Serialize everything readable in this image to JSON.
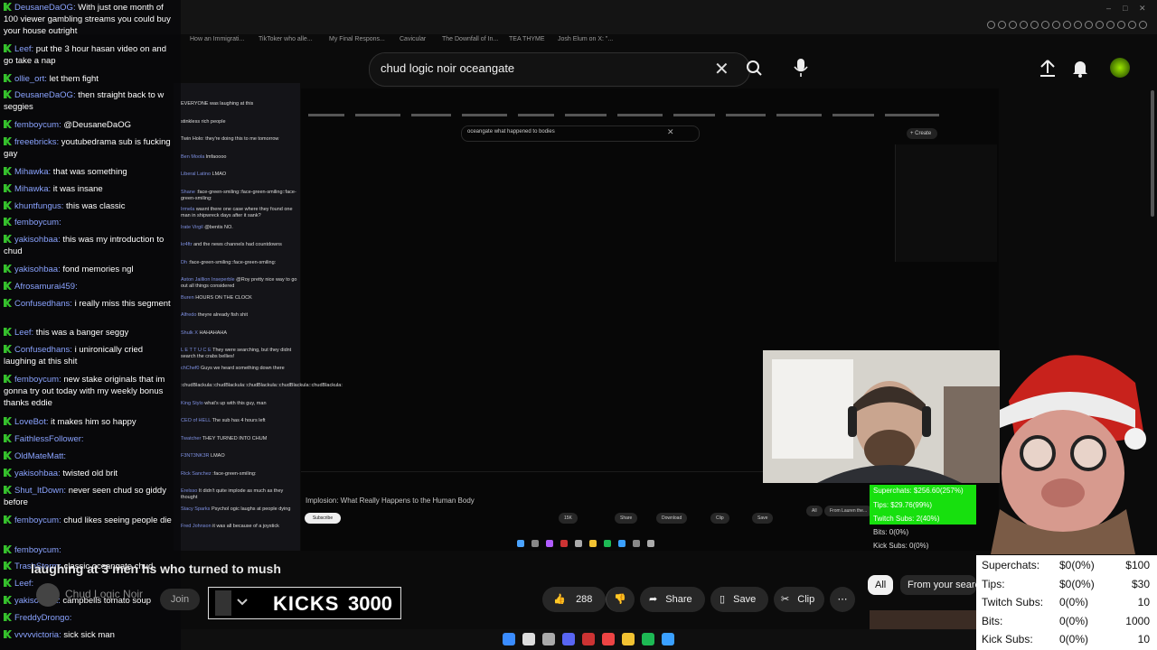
{
  "browser": {
    "bookmarks": [
      "How an Immigrati...",
      "TikToker who alle...",
      "My Final Respons...",
      "Cavicular",
      "The Downfall of In...",
      "TEA THYME",
      "Josh Elum on X: \"..."
    ]
  },
  "youtube": {
    "search_value": "chud logic noir oceangate",
    "video_subtitle": "laughing at 3 men hs who turned to mush",
    "channel_name": "Chud Logic Noir",
    "join_label": "Join",
    "like_count": "288",
    "share_label": "Share",
    "save_label": "Save",
    "clip_label": "Clip",
    "chips": [
      "All",
      "From your search"
    ]
  },
  "embedded": {
    "search_value": "oceangate what happened to bodies",
    "create_label": "Create",
    "video_title": "Implosion: What Really Happens to the Human Body",
    "subscribe_label": "Subscribe",
    "actions": [
      "15K",
      "Share",
      "Download",
      "Clip",
      "Save"
    ],
    "chips": [
      "All",
      "From Lauren the..."
    ]
  },
  "kicks": {
    "label": "KICKS",
    "value": "3000"
  },
  "overlay_green": {
    "superchats": "Superchats: $256.60(257%)",
    "tips": "Tips: $29.76(99%)",
    "twitch": "Twitch Subs: 2(40%)",
    "bits": "Bits: 0(0%)",
    "kick": "Kick Subs: 0(0%)"
  },
  "stats": [
    {
      "label": "Superchats:",
      "value": "$0(0%)",
      "goal": "$100"
    },
    {
      "label": "Tips:",
      "value": "$0(0%)",
      "goal": "$30"
    },
    {
      "label": "Twitch Subs:",
      "value": "0(0%)",
      "goal": "10"
    },
    {
      "label": "Bits:",
      "value": "0(0%)",
      "goal": "1000"
    },
    {
      "label": "Kick Subs:",
      "value": "0(0%)",
      "goal": "10"
    }
  ],
  "chat": [
    {
      "user": "DeusaneDaOG",
      "text": "With just one month of 100 viewer gambling streams you could buy your house outright"
    },
    {
      "user": "Leef",
      "text": "put the 3 hour hasan video on and go take a nap"
    },
    {
      "user": "ollie_ort",
      "text": "let them fight"
    },
    {
      "user": "DeusaneDaOG",
      "text": "then straight back to w seggies"
    },
    {
      "user": "femboycum",
      "text": "@DeusaneDaOG"
    },
    {
      "user": "freeebricks",
      "text": "youtubedrama sub is fucking gay"
    },
    {
      "user": "Mihawka",
      "text": "that was something"
    },
    {
      "user": "Mihawka",
      "text": "it was insane"
    },
    {
      "user": "khuntfungus",
      "text": "this was classic"
    },
    {
      "user": "femboycum",
      "text": ""
    },
    {
      "user": "yakisohbaa",
      "text": "this was my introduction to chud"
    },
    {
      "user": "yakisohbaa",
      "text": "fond memories ngl"
    },
    {
      "user": "Afrosamurai459",
      "text": ""
    },
    {
      "user": "Confusedhans",
      "text": "i really miss this segment"
    },
    {
      "user": "Leef",
      "text": "this was a banger seggy"
    },
    {
      "user": "Confusedhans",
      "text": "i unironically cried laughing at this shit"
    },
    {
      "user": "femboycum",
      "text": "new stake originals that im gonna try out today with my weekly bonus thanks eddie"
    },
    {
      "user": "LoveBot",
      "text": "it makes him so happy"
    },
    {
      "user": "FaithlessFollower",
      "text": ""
    },
    {
      "user": "OldMateMatt",
      "text": ""
    },
    {
      "user": "yakisohbaa",
      "text": "twisted old brit"
    },
    {
      "user": "Shut_ItDown",
      "text": "never seen chud so giddy before"
    },
    {
      "user": "femboycum",
      "text": "chud likes seeing people die"
    },
    {
      "user": "femboycum",
      "text": ""
    },
    {
      "user": "TrashStorm",
      "text": "classic oceangate chud"
    },
    {
      "user": "Leef",
      "text": ""
    },
    {
      "user": "yakisohbaa",
      "text": "campbells tomato soup"
    },
    {
      "user": "FreddyDrongo",
      "text": ""
    },
    {
      "user": "vvvvvictoria",
      "text": "sick sick man"
    }
  ],
  "chat2": [
    {
      "user": "",
      "text": "EVERYONE was laughing at this"
    },
    {
      "user": "",
      "text": "stinkless rich people"
    },
    {
      "user": "",
      "text": "Twin Holo: they're doing this to me tomorrow"
    },
    {
      "user": "Ben Moola",
      "text": "lmfaoooo"
    },
    {
      "user": "Liberal Latino",
      "text": "LMAO"
    },
    {
      "user": "Shane",
      "text": ":face-green-smiling::face-green-smiling::face-green-smiling:"
    },
    {
      "user": "Irmela",
      "text": "wasnt there one case where they found one man in shipwreck days after it sank?"
    },
    {
      "user": "Irate Virgil",
      "text": "@bentis NO."
    },
    {
      "user": "kr4ftr",
      "text": "and the news channels had countdowns"
    },
    {
      "user": "Dh",
      "text": ":face-green-smiling::face-green-smiling:"
    },
    {
      "user": "Aston Jaillion Inseperble",
      "text": "@Roy pretty nice way to go out all things considered"
    },
    {
      "user": "Buren",
      "text": "HOURS ON THE CLOCK"
    },
    {
      "user": "Alfredo",
      "text": "theyre already fish shit"
    },
    {
      "user": "Shulk X",
      "text": "HAHAHAHA"
    },
    {
      "user": "L E T T U C E",
      "text": "They were searching, but they didnt search the crabs bellies!"
    },
    {
      "user": "chChef0",
      "text": "Guys we heard something down there"
    },
    {
      "user": "",
      "text": ":chudBlackula::chudBlackula::chudBlackula::chudBlackula::chudBlackula:"
    },
    {
      "user": "King Stylo",
      "text": "what's up with this guy, man"
    },
    {
      "user": "CEO of HELL",
      "text": "The sub has 4 hours left"
    },
    {
      "user": "Twatcher",
      "text": "THEY TURNED INTO CHUM"
    },
    {
      "user": "F3NT3NK3R",
      "text": "LMAO"
    },
    {
      "user": "Rick Sanchez",
      "text": ":face-green-smiling:"
    },
    {
      "user": "Erelsso",
      "text": "It didn't quite implode as much as they thought"
    },
    {
      "user": "Stacy Sparks",
      "text": "Psychol ogic laughs at people dying"
    },
    {
      "user": "Fred Johnson",
      "text": "it was all because of a joystick"
    }
  ]
}
